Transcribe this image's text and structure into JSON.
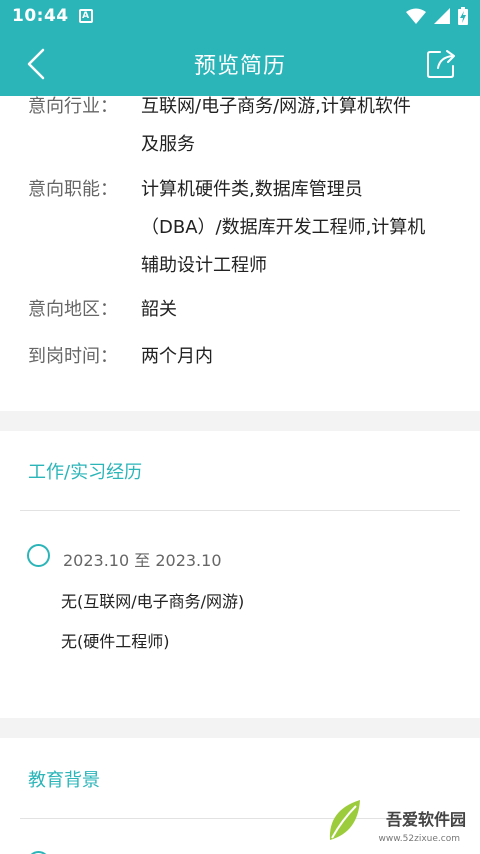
{
  "status_bar": {
    "time": "10:44",
    "notification_glyph": "A"
  },
  "app_bar": {
    "title": "预览简历"
  },
  "intent": [
    {
      "label": "意向行业：",
      "lines": [
        "互联网/电子商务/网游,计算机软件",
        "及服务"
      ]
    },
    {
      "label": "意向职能：",
      "lines": [
        "计算机硬件类,数据库管理员",
        "（DBA）/数据库开发工程师,计算机",
        "辅助设计工程师"
      ]
    },
    {
      "label": "意向地区：",
      "lines": [
        "韶关"
      ]
    },
    {
      "label": "到岗时间：",
      "lines": [
        "两个月内"
      ]
    }
  ],
  "work": {
    "title": "工作/实习经历",
    "entry": {
      "date": "2023.10  至  2023.10",
      "company": "无(互联网/电子商务/网游)",
      "position": "无(硬件工程师)"
    }
  },
  "education": {
    "title": "教育背景"
  },
  "watermark": {
    "name": "吾爱软件园",
    "url": "www.52zixue.com"
  },
  "colors": {
    "accent": "#2bb5b9",
    "gap": "#f3f3f3"
  }
}
